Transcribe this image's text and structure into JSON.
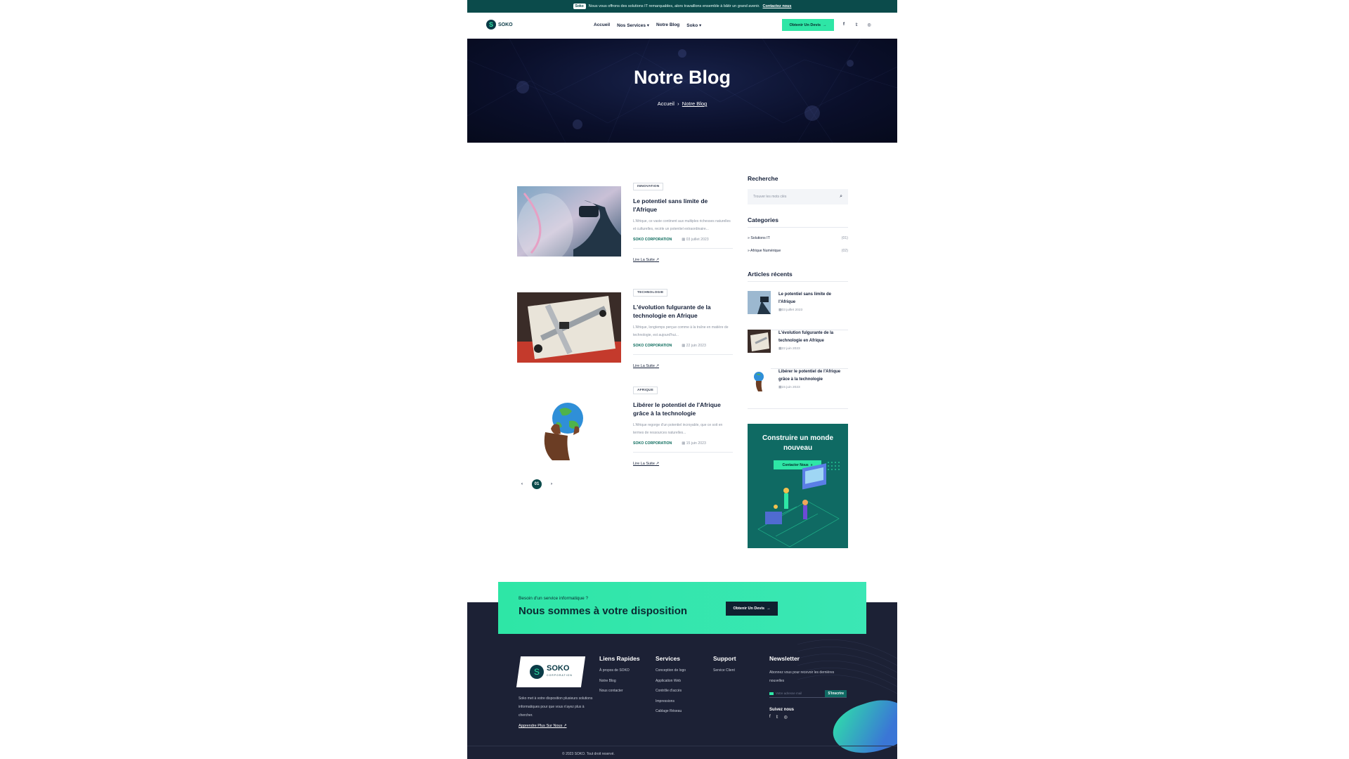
{
  "colors": {
    "teal_dark": "#0b4b4b",
    "mint": "#2ee6a6",
    "navy": "#16213a",
    "footer_bg": "#1c2135"
  },
  "topbar": {
    "badge": "Soko",
    "text": "Nous vous offrons des solutions IT remarquables, alors travaillons ensemble à bâtir un grand avenir.",
    "link": "Contactez nous"
  },
  "header": {
    "brand": "SOKO",
    "nav": [
      "Accueil",
      "Nos Services",
      "Notre Blog",
      "Soko"
    ],
    "quote_button": "Obtenir Un Devis",
    "social_icons": [
      "facebook-icon",
      "twitter-icon",
      "instagram-icon"
    ]
  },
  "hero": {
    "title": "Notre Blog",
    "breadcrumb_home": "Accueil",
    "breadcrumb_current": "Notre Blog"
  },
  "posts": [
    {
      "tag": "INNOVATION",
      "title": "Le potentiel sans limite de l'Afrique",
      "excerpt": "L'Afrique, ce vaste continent aux multiples richesses naturelles et culturelles, recèle un potentiel extraordinaire...",
      "author": "SOKO CORPORATION",
      "date": "03 juillet 2023",
      "more": "Lire La Suite"
    },
    {
      "tag": "TECHNOLOGIE",
      "title": "L'évolution fulgurante de la technologie en Afrique",
      "excerpt": "L'Afrique, longtemps perçue comme à la traîne en matière de technologie, est aujourd'hui...",
      "author": "SOKO CORPORATION",
      "date": "22 juin 2023",
      "more": "Lire La Suite"
    },
    {
      "tag": "AFRIQUE",
      "title": "Libérer le potentiel de l'Afrique grâce à la technologie",
      "excerpt": "L'Afrique regorge d'un potentiel incroyable, que ce soit en termes de ressources naturelles...",
      "author": "SOKO CORPORATION",
      "date": "15 juin 2023",
      "more": "Lire La Suite"
    }
  ],
  "pagination": {
    "current": "01"
  },
  "sidebar": {
    "search_title": "Recherche",
    "search_placeholder": "Trouver les mots clés",
    "categories_title": "Categories",
    "categories": [
      {
        "name": "Solutions IT",
        "count": "(01)"
      },
      {
        "name": "Afrique Numérique",
        "count": "(02)"
      }
    ],
    "recent_title": "Articles récents",
    "recent": [
      {
        "title": "Le potentiel sans limite de l'Afrique",
        "date": "03 juillet 2023"
      },
      {
        "title": "L'évolution fulgurante de la technologie en Afrique",
        "date": "22 juin 2023"
      },
      {
        "title": "Libérer le potentiel de l'Afrique grâce à la technologie",
        "date": "15 juin 2023"
      }
    ],
    "promo_title": "Construire un monde nouveau",
    "promo_button": "Contacter Nous"
  },
  "cta": {
    "small": "Besoin d'un service informatique ?",
    "big": "Nous sommes à votre disposition",
    "button": "Obtenir Un Devis"
  },
  "footer": {
    "brand": "SOKO",
    "brand_sub": "CORPORATION",
    "description": "Soko met à votre disposition plusieurs solutions informatiques pour que vous n'ayez plus à chercher.",
    "learn_more": "Apprendre Plus Sur Nous",
    "quick_title": "Liens Rapides",
    "quick_links": [
      "À propos de SOKO",
      "Notre Blog",
      "Nous contacter"
    ],
    "services_title": "Services",
    "services": [
      "Conception de logo",
      "Application Web",
      "Contrôle d'accès",
      "Impressions",
      "Cablage Réseau"
    ],
    "support_title": "Support",
    "support": [
      "Service Client"
    ],
    "newsletter_title": "Newsletter",
    "newsletter_text": "Abonnez vous pour recevoir les dernières nouvelles",
    "newsletter_placeholder": "Votre adresse mail",
    "newsletter_button": "S'inscrire",
    "follow_title": "Suivez nous",
    "copyright": "© 2023 SOKO. Tout droit reservé."
  }
}
